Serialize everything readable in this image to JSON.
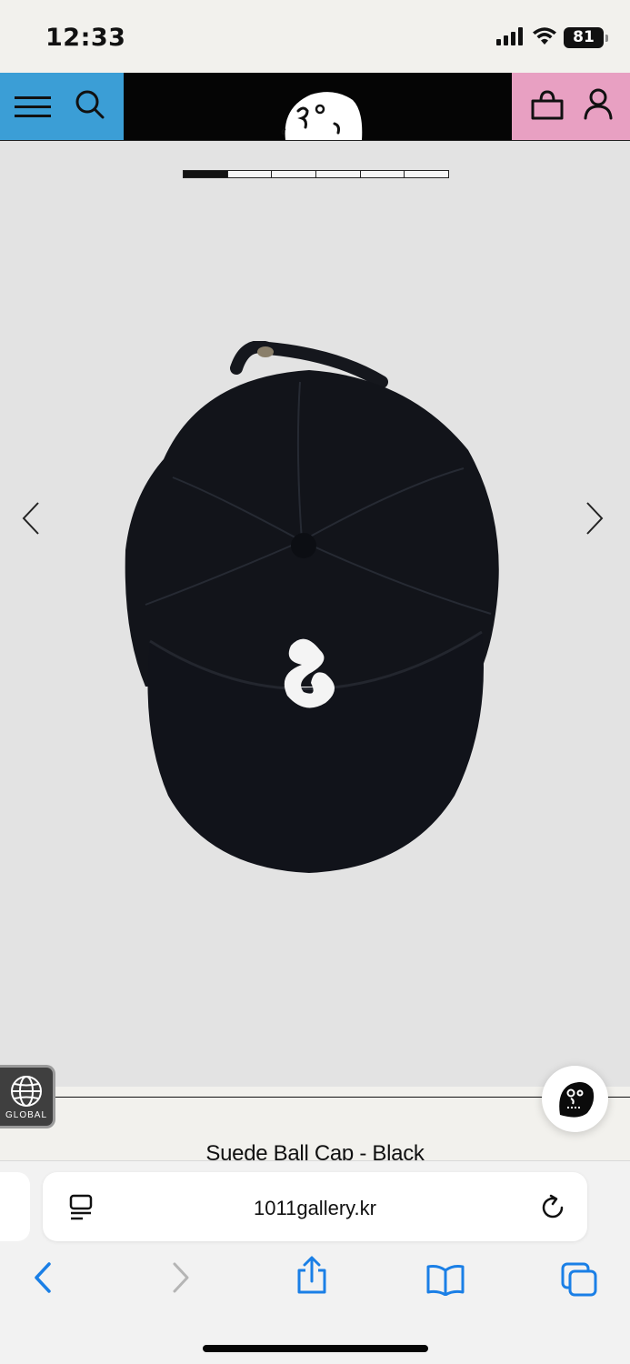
{
  "status_bar": {
    "time": "12:33",
    "battery": "81",
    "icons": [
      "cellular-signal-icon",
      "wifi-icon",
      "battery-icon"
    ]
  },
  "header": {
    "left_color": "#3b9ed6",
    "right_color": "#e8a0c2",
    "icons": [
      "hamburger-menu-icon",
      "search-icon",
      "logo-face-icon",
      "shopping-bag-icon",
      "user-account-icon"
    ]
  },
  "gallery": {
    "slide_count": 6,
    "active_slide": 1,
    "icons": [
      "chevron-left-icon",
      "chevron-right-icon"
    ]
  },
  "product": {
    "title": "Suede Ball Cap - Black"
  },
  "floating": {
    "global_label": "GLOBAL",
    "icons": [
      "globe-icon",
      "chat-face-icon"
    ]
  },
  "browser": {
    "url": "1011gallery.kr",
    "icons": [
      "page-menu-icon",
      "reload-icon",
      "back-icon",
      "forward-icon",
      "share-icon",
      "bookmarks-icon",
      "tabs-icon"
    ]
  }
}
